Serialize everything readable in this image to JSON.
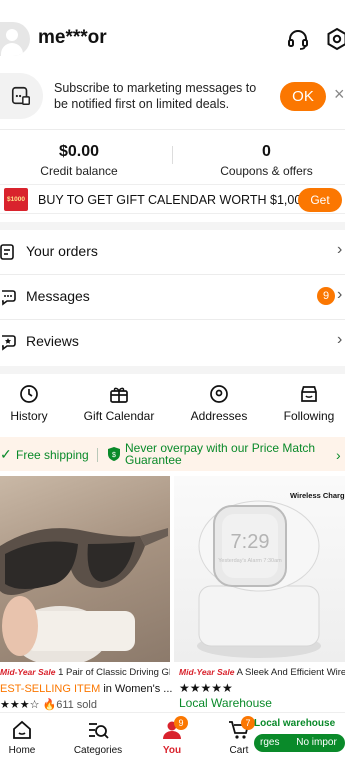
{
  "header": {
    "username": "me***or",
    "support_icon": "headset-icon",
    "settings_icon": "gear-icon"
  },
  "subscribe": {
    "text": "Subscribe to marketing messages to be notified first on limited deals.",
    "ok_label": "OK",
    "close_label": "×"
  },
  "balance": {
    "credit_value": "$0.00",
    "credit_label": "Credit balance",
    "coupons_value": "0",
    "coupons_label": "Coupons & offers"
  },
  "gift_banner": {
    "badge_text": "$1000",
    "text": "BUY TO GET GIFT CALENDAR WORTH $1,000+",
    "button_label": "Get"
  },
  "menu": [
    {
      "label": "Your orders",
      "icon": "orders-icon"
    },
    {
      "label": "Messages",
      "icon": "message-icon",
      "badge": "9"
    },
    {
      "label": "Reviews",
      "icon": "review-icon"
    }
  ],
  "quick_links": [
    {
      "label": "History",
      "icon": "clock-icon"
    },
    {
      "label": "Gift Calendar",
      "icon": "gift-icon"
    },
    {
      "label": "Addresses",
      "icon": "location-icon"
    },
    {
      "label": "Following",
      "icon": "store-icon"
    }
  ],
  "shipping": {
    "free": "Free shipping",
    "match": "Never overpay with our Price Match Guarantee"
  },
  "products": [
    {
      "sale_tag": "Mid-Year Sale",
      "title": "1 Pair of Classic Driving Gl...",
      "best_selling": "EST-SELLING ITEM",
      "best_rest": "in Women's ...",
      "rating_stars": 3,
      "sold": "611 sold"
    },
    {
      "sale_tag": "Mid-Year Sale",
      "title": "A Sleek And Efficient Wire",
      "image_label": "Wireless Charg",
      "watch_time": "7:29",
      "watch_sub": "Yesterday's Alarm 7:30am",
      "rating_stars": 4.5,
      "local": "Local Warehouse"
    }
  ],
  "bottom_nav": [
    {
      "label": "Home",
      "icon": "home-icon"
    },
    {
      "label": "Categories",
      "icon": "categories-search-icon"
    },
    {
      "label": "You",
      "icon": "user-icon",
      "badge": "9",
      "active": true
    },
    {
      "label": "Cart",
      "icon": "cart-icon",
      "badge": "7"
    }
  ],
  "local_warehouse_pill": {
    "title": "Local warehouse",
    "strip_left": "rges",
    "strip_right": "No impor"
  },
  "colors": {
    "accent": "#fb7701",
    "green": "#0a8a2a",
    "sale_red": "#d9232d"
  }
}
